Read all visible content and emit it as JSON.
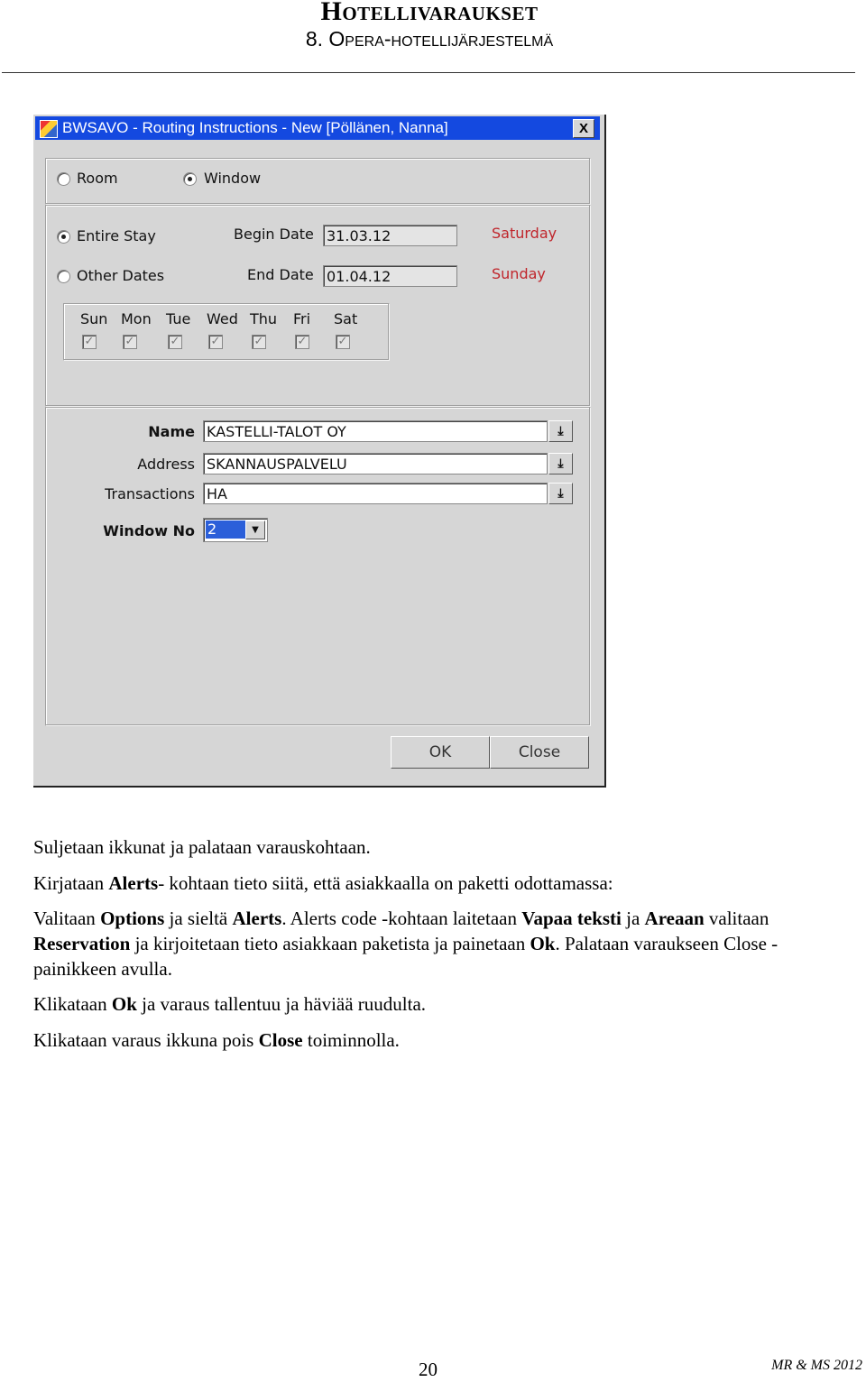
{
  "header": {
    "title": "Hotellivaraukset",
    "subtitle": "8. Opera-hotellijärjestelmä"
  },
  "dialog": {
    "title": "BWSAVO - Routing Instructions - New [Pöllänen, Nanna]",
    "close_glyph": "X",
    "routing_type": {
      "room_label": "Room",
      "window_label": "Window",
      "selected": "Window"
    },
    "stay": {
      "entire_label": "Entire Stay",
      "other_label": "Other Dates",
      "selected": "Entire Stay"
    },
    "begin_date_label": "Begin Date",
    "begin_date": "31.03.12",
    "begin_day": "Saturday",
    "end_date_label": "End Date",
    "end_date": "01.04.12",
    "end_day": "Sunday",
    "days": [
      {
        "label": "Sun",
        "checked": true
      },
      {
        "label": "Mon",
        "checked": true
      },
      {
        "label": "Tue",
        "checked": true
      },
      {
        "label": "Wed",
        "checked": true
      },
      {
        "label": "Thu",
        "checked": true
      },
      {
        "label": "Fri",
        "checked": true
      },
      {
        "label": "Sat",
        "checked": true
      }
    ],
    "check_glyph": "✓",
    "name_label": "Name",
    "name_value": "KASTELLI-TALOT OY",
    "address_label": "Address",
    "address_value": "SKANNAUSPALVELU",
    "transactions_label": "Transactions",
    "transactions_value": "HA",
    "window_no_label": "Window No",
    "window_no_value": "2",
    "ok_label": "OK",
    "close_label": "Close",
    "colors": {
      "titlebar": "#1449e0",
      "day_text": "#c0262c",
      "selection": "#2b5fd9"
    }
  },
  "paragraphs": [
    [
      {
        "text": "Suljetaan ikkunat ja palataan varauskohtaan.",
        "bold": false
      }
    ],
    [
      {
        "text": "Kirjataan ",
        "bold": false
      },
      {
        "text": "Alerts",
        "bold": true
      },
      {
        "text": "- kohtaan tieto siitä, että asiakkaalla on paketti odottamassa:",
        "bold": false
      }
    ],
    [
      {
        "text": "Valitaan ",
        "bold": false
      },
      {
        "text": "Options",
        "bold": true
      },
      {
        "text": " ja sieltä ",
        "bold": false
      },
      {
        "text": "Alerts",
        "bold": true
      },
      {
        "text": ". Alerts code -kohtaan laitetaan ",
        "bold": false
      },
      {
        "text": "Vapaa teksti",
        "bold": true
      },
      {
        "text": " ja ",
        "bold": false
      },
      {
        "text": "Areaan",
        "bold": true
      },
      {
        "text": " valitaan ",
        "bold": false
      },
      {
        "text": "Reservation",
        "bold": true
      },
      {
        "text": " ja kirjoitetaan tieto asiakkaan paketista ja painetaan ",
        "bold": false
      },
      {
        "text": "Ok",
        "bold": true
      },
      {
        "text": ". Palataan varaukseen Close -painikkeen avulla.",
        "bold": false
      }
    ],
    [
      {
        "text": "Klikataan ",
        "bold": false
      },
      {
        "text": "Ok",
        "bold": true
      },
      {
        "text": " ja varaus tallentuu ja häviää ruudulta.",
        "bold": false
      }
    ],
    [
      {
        "text": "Klikataan varaus ikkuna pois ",
        "bold": false
      },
      {
        "text": "Close",
        "bold": true
      },
      {
        "text": " toiminnolla.",
        "bold": false
      }
    ]
  ],
  "footer": {
    "page_number": "20",
    "credit": "MR & MS 2012"
  }
}
